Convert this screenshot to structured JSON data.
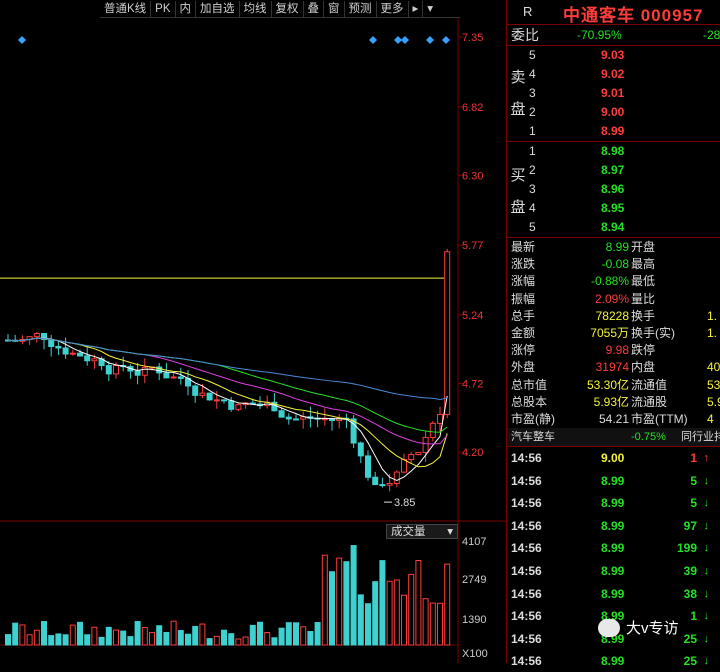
{
  "toolbar": {
    "items": [
      "普通K线",
      "PK",
      "内",
      "加自选",
      "均线",
      "复权",
      "叠",
      "窗",
      "预测",
      "更多"
    ]
  },
  "chart_data": {
    "type": "candlestick",
    "price_ticks": [
      "7.35",
      "6.82",
      "6.30",
      "5.77",
      "5.24",
      "4.72",
      "4.20"
    ],
    "low_marker": "3.85",
    "volume_ticks": [
      "4107",
      "2749",
      "1390",
      "X100"
    ],
    "volume_tag": "成交量",
    "ylim": [
      3.6,
      7.4
    ]
  },
  "quote": {
    "r_label": "R",
    "title": "中通客车 000957",
    "weibi_label": "委比",
    "weibi_value": "-70.95%",
    "weibi_extra": "-28",
    "sell_label": [
      "卖",
      "盘"
    ],
    "buy_label": [
      "买",
      "盘"
    ],
    "sell": [
      {
        "lvl": "5",
        "price": "9.03"
      },
      {
        "lvl": "4",
        "price": "9.02"
      },
      {
        "lvl": "3",
        "price": "9.01"
      },
      {
        "lvl": "2",
        "price": "9.00"
      },
      {
        "lvl": "1",
        "price": "8.99"
      }
    ],
    "buy": [
      {
        "lvl": "1",
        "price": "8.98"
      },
      {
        "lvl": "2",
        "price": "8.97"
      },
      {
        "lvl": "3",
        "price": "8.96"
      },
      {
        "lvl": "4",
        "price": "8.95"
      },
      {
        "lvl": "5",
        "price": "8.94"
      }
    ],
    "stats": [
      {
        "l1": "最新",
        "v1": "8.99",
        "l2": "开盘",
        "v2": ""
      },
      {
        "l1": "涨跌",
        "v1": "-0.08",
        "l2": "最高",
        "v2": ""
      },
      {
        "l1": "涨幅",
        "v1": "-0.88%",
        "l2": "最低",
        "v2": ""
      },
      {
        "l1": "振幅",
        "v1": "2.09%",
        "l2": "量比",
        "v2": ""
      },
      {
        "l1": "总手",
        "v1": "78228",
        "l2": "换手",
        "v2": "1."
      },
      {
        "l1": "金额",
        "v1": "7055万",
        "l2": "换手(实)",
        "v2": "1."
      },
      {
        "l1": "涨停",
        "v1": "9.98",
        "l2": "跌停",
        "v2": ""
      },
      {
        "l1": "外盘",
        "v1": "31974",
        "l2": "内盘",
        "v2": "40"
      },
      {
        "l1": "总市值",
        "v1": "53.30亿",
        "l2": "流通值",
        "v2": "53.3"
      },
      {
        "l1": "总股本",
        "v1": "5.93亿",
        "l2": "流通股",
        "v2": "5.9"
      },
      {
        "l1": "市盈(静)",
        "v1": "54.21",
        "l2": "市盈(TTM)",
        "v2": "4"
      }
    ],
    "sector_name": "汽车整车",
    "sector_change": "-0.75%",
    "sector_rank": "同行业排",
    "ticks": [
      {
        "time": "14:56",
        "price": "9.00",
        "vol": "1"
      },
      {
        "time": "14:56",
        "price": "8.99",
        "vol": "5"
      },
      {
        "time": "14:56",
        "price": "8.99",
        "vol": "5"
      },
      {
        "time": "14:56",
        "price": "8.99",
        "vol": "97"
      },
      {
        "time": "14:56",
        "price": "8.99",
        "vol": "199"
      },
      {
        "time": "14:56",
        "price": "8.99",
        "vol": "39"
      },
      {
        "time": "14:56",
        "price": "8.99",
        "vol": "38"
      },
      {
        "time": "14:56",
        "price": "8.99",
        "vol": "1"
      },
      {
        "time": "14:56",
        "price": "8.99",
        "vol": "25"
      },
      {
        "time": "14:56",
        "price": "8.99",
        "vol": "25"
      }
    ]
  },
  "watermark": "大v专访"
}
